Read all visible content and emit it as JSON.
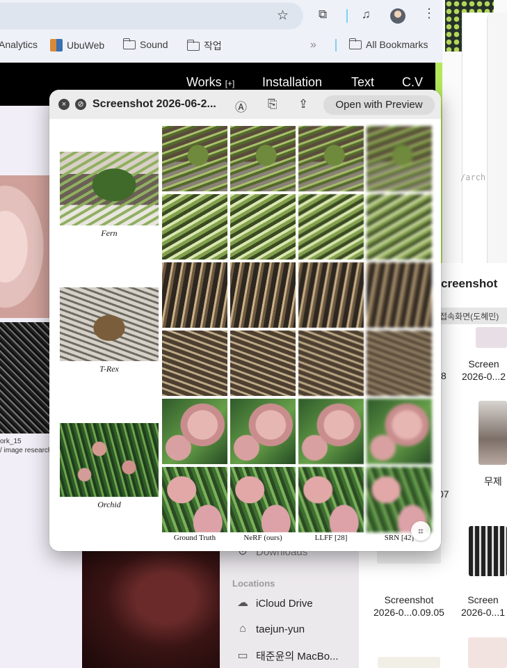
{
  "browser": {
    "bookmarks": [
      {
        "label": "Analytics",
        "type": "text"
      },
      {
        "label": "UbuWeb",
        "type": "logo"
      },
      {
        "label": "Sound",
        "type": "folder"
      },
      {
        "label": "작업",
        "type": "folder"
      }
    ],
    "all_bookmarks": "All Bookmarks",
    "overflow": "»",
    "icons": [
      "star-icon",
      "extensions-icon",
      "media-icon",
      "avatar",
      "menu-dots-icon"
    ]
  },
  "site": {
    "nav": [
      {
        "label": "Works",
        "suffix": "[+]"
      },
      {
        "label": "Installation",
        "suffix": ""
      },
      {
        "label": "Text",
        "suffix": ""
      },
      {
        "label": "C.V",
        "suffix": ""
      }
    ],
    "work_title": "ork_15",
    "work_caption": "/ image research"
  },
  "right_window": {
    "code_text": "/arch"
  },
  "finder": {
    "title": "creenshot",
    "path_chip": "접속화면(도혜민)",
    "items": [
      {
        "line1": "Screen",
        "line2": "2026-0...2"
      },
      {
        "line1": "무제",
        "line2": ""
      },
      {
        "line1": "Screenshot",
        "line2": "2026-0...0.09.05"
      },
      {
        "line1": "Screen",
        "line2": "2026-0...1"
      }
    ],
    "partial_labels": [
      "8",
      "07"
    ],
    "sidebar": {
      "downloads": "Downloads",
      "locations_header": "Locations",
      "locations": [
        {
          "label": "iCloud Drive",
          "icon": "cloud-icon"
        },
        {
          "label": "taejun-yun",
          "icon": "home-icon"
        },
        {
          "label": "태준윤의 MacBo...",
          "icon": "laptop-icon"
        }
      ]
    }
  },
  "quicklook": {
    "title": "Screenshot 2026-06-2...",
    "open_button": "Open with Preview",
    "close_glyph": "×",
    "fullscreen_glyph": "⊘"
  },
  "chart_data": {
    "type": "table",
    "columns": [
      "Ground Truth",
      "NeRF (ours)",
      "LLFF [28]",
      "SRN [42]"
    ],
    "scenes": [
      "Fern",
      "T-Rex",
      "Orchid"
    ]
  }
}
